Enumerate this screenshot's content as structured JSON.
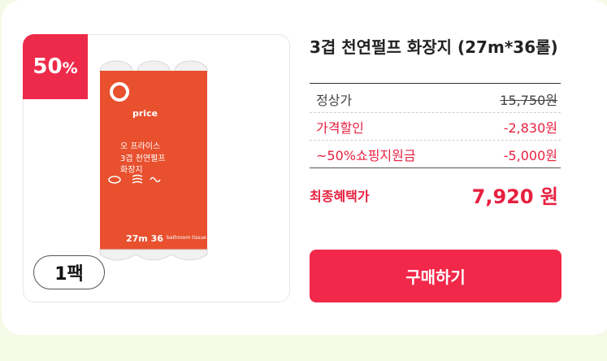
{
  "product": {
    "discount_badge": {
      "number": "50",
      "percent_sign": "%"
    },
    "pack_label": "1팩",
    "title": "3겹 천연펄프 화장지 (27m*36롤)",
    "image_text": {
      "brand": "price",
      "name_line1": "오 프라이스",
      "name_line2": "3겹 천연펄프",
      "name_line3": "화장지",
      "spec": "27m 36",
      "footer": "bathroom tissue"
    }
  },
  "prices": {
    "regular": {
      "label": "정상가",
      "value": "15,750원"
    },
    "discount": {
      "label": "가격할인",
      "value": "-2,830원"
    },
    "subsidy": {
      "label": "~50%쇼핑지원금",
      "value": "-5,000원"
    },
    "final": {
      "label": "최종혜택가",
      "value": "7,920 원"
    }
  },
  "actions": {
    "buy_label": "구매하기"
  },
  "colors": {
    "accent": "#f2284a",
    "product_orange": "#e8502e",
    "background": "#f4fae6"
  }
}
